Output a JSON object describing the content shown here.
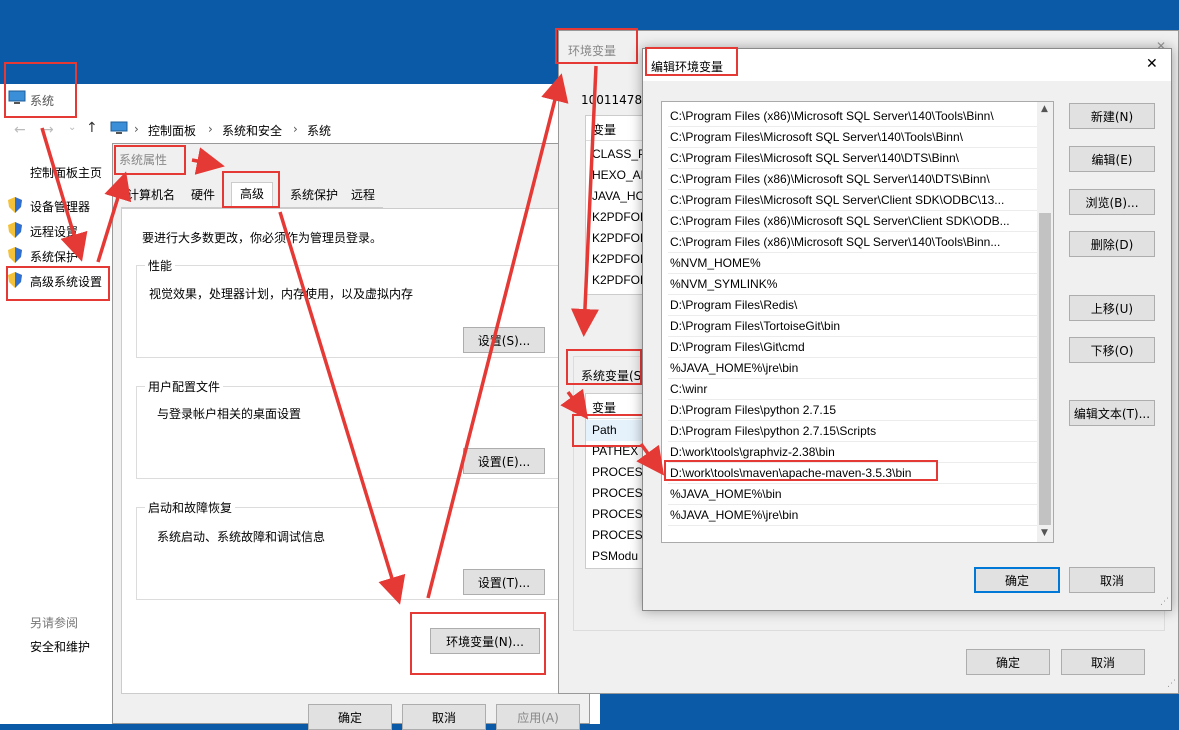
{
  "system_window": {
    "title": "系统",
    "breadcrumb": [
      "控制面板",
      "系统和安全",
      "系统"
    ],
    "sidebar": {
      "home": "控制面板主页",
      "items": [
        "设备管理器",
        "远程设置",
        "系统保护",
        "高级系统设置"
      ],
      "see_also_title": "另请参阅",
      "see_also_items": [
        "安全和维护"
      ]
    },
    "partial_id": "10011478"
  },
  "system_properties": {
    "title": "系统属性",
    "tabs": [
      "计算机名",
      "硬件",
      "高级",
      "系统保护",
      "远程"
    ],
    "active_tab": "高级",
    "admin_note": "要进行大多数更改，你必须作为管理员登录。",
    "performance": {
      "title": "性能",
      "desc": "视觉效果，处理器计划，内存使用，以及虚拟内存",
      "button": "设置(S)..."
    },
    "user_profile": {
      "title": "用户配置文件",
      "desc": "与登录帐户相关的桌面设置",
      "button": "设置(E)..."
    },
    "startup": {
      "title": "启动和故障恢复",
      "desc": "系统启动、系统故障和调试信息",
      "button": "设置(T)..."
    },
    "env_button": "环境变量(N)...",
    "ok": "确定",
    "cancel": "取消",
    "apply": "应用(A)"
  },
  "env_variables": {
    "title": "环境变量",
    "user_vars_header": "变量",
    "user_vars": [
      "CLASS_PA",
      "HEXO_AL",
      "JAVA_HO",
      "K2PDFOF",
      "K2PDFOF",
      "K2PDFOF",
      "K2PDFOF"
    ],
    "system_vars_title": "系统变量(S",
    "system_vars_header": "变量",
    "system_vars": [
      "Path",
      "PATHEX",
      "PROCESS",
      "PROCESS",
      "PROCESS",
      "PROCESS",
      "PSModu"
    ],
    "ok": "确定",
    "cancel": "取消"
  },
  "edit_env": {
    "title": "编辑环境变量",
    "close_glyph": "✕",
    "paths": [
      "C:\\Program Files (x86)\\Microsoft SQL Server\\140\\Tools\\Binn\\",
      "C:\\Program Files\\Microsoft SQL Server\\140\\Tools\\Binn\\",
      "C:\\Program Files\\Microsoft SQL Server\\140\\DTS\\Binn\\",
      "C:\\Program Files (x86)\\Microsoft SQL Server\\140\\DTS\\Binn\\",
      "C:\\Program Files\\Microsoft SQL Server\\Client SDK\\ODBC\\13...",
      "C:\\Program Files (x86)\\Microsoft SQL Server\\Client SDK\\ODB...",
      "C:\\Program Files (x86)\\Microsoft SQL Server\\140\\Tools\\Binn...",
      "%NVM_HOME%",
      "%NVM_SYMLINK%",
      "D:\\Program Files\\Redis\\",
      "D:\\Program Files\\TortoiseGit\\bin",
      "D:\\Program Files\\Git\\cmd",
      "%JAVA_HOME%\\jre\\bin",
      "C:\\winr",
      "D:\\Program Files\\python 2.7.15",
      "D:\\Program Files\\python 2.7.15\\Scripts",
      "D:\\work\\tools\\graphviz-2.38\\bin",
      "D:\\work\\tools\\maven\\apache-maven-3.5.3\\bin",
      "%JAVA_HOME%\\bin",
      "%JAVA_HOME%\\jre\\bin"
    ],
    "highlighted_index": 17,
    "buttons": {
      "new": "新建(N)",
      "edit": "编辑(E)",
      "browse": "浏览(B)...",
      "delete": "删除(D)",
      "up": "上移(U)",
      "down": "下移(O)",
      "edit_text": "编辑文本(T)..."
    },
    "ok": "确定",
    "cancel": "取消"
  },
  "colors": {
    "annotation_red": "#e53935",
    "desktop_blue": "#0a5aa8",
    "accent": "#0078d7"
  }
}
